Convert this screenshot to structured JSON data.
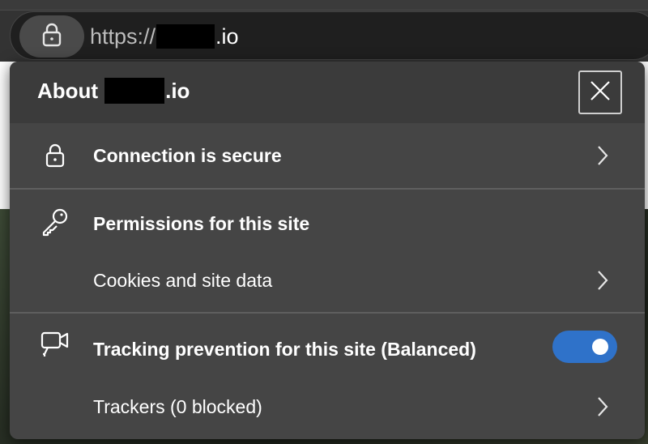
{
  "address_bar": {
    "scheme": "https://",
    "domain_suffix": ".io"
  },
  "popup": {
    "title_prefix": "About",
    "title_suffix": ".io",
    "close_icon": "close-icon",
    "rows": {
      "connection": {
        "label": "Connection is secure",
        "icon": "lock-icon"
      },
      "permissions": {
        "label": "Permissions for this site",
        "icon": "key-icon"
      },
      "cookies": {
        "label": "Cookies and site data"
      },
      "tracking": {
        "label": "Tracking prevention for this site (Balanced)",
        "icon": "camera-icon",
        "enabled": true
      },
      "trackers": {
        "label": "Trackers (0 blocked)"
      }
    }
  },
  "colors": {
    "accent": "#2f72c9",
    "panel": "#454545",
    "header": "#3b3b3b"
  }
}
